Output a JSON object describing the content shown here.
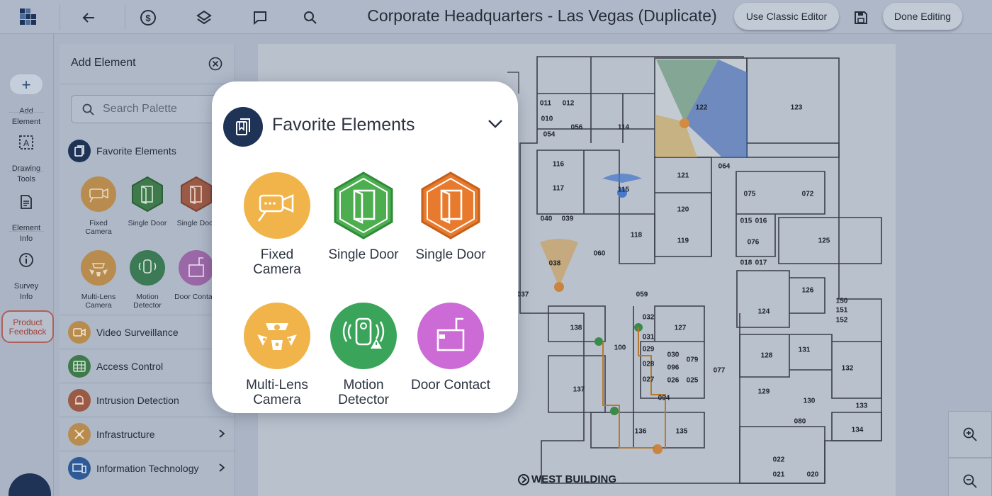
{
  "topbar": {
    "title": "Corporate Headquarters - Las Vegas (Duplicate)",
    "classic_editor_label": "Use Classic Editor",
    "done_editing_label": "Done Editing"
  },
  "rail": {
    "add_element": "Add\nElement",
    "drawing_tools": "Drawing\nTools",
    "element_info": "Element\nInfo",
    "survey_info": "Survey\nInfo",
    "product_feedback": "Product\nFeedback"
  },
  "panel": {
    "header": "Add Element",
    "search_placeholder": "Search Palette",
    "favorites_label": "Favorite Elements",
    "favorites": [
      {
        "label": "Fixed\nCamera",
        "icon": "fixed-camera-icon"
      },
      {
        "label": "Single Door",
        "icon": "single-door-icon"
      },
      {
        "label": "Single Door",
        "icon": "single-door-icon"
      },
      {
        "label": "Multi-Lens\nCamera",
        "icon": "multi-lens-camera-icon"
      },
      {
        "label": "Motion\nDetector",
        "icon": "motion-detector-icon"
      },
      {
        "label": "Door Contact",
        "icon": "door-contact-icon"
      }
    ],
    "categories": [
      {
        "label": "Video Surveillance",
        "color": "#d9893a"
      },
      {
        "label": "Access Control",
        "color": "#3f8f4a"
      },
      {
        "label": "Intrusion Detection",
        "color": "#c9553d"
      },
      {
        "label": "Infrastructure",
        "color": "#d9893a"
      },
      {
        "label": "Information Technology",
        "color": "#2f64b5"
      }
    ]
  },
  "popover": {
    "title": "Favorite Elements",
    "tiles": [
      {
        "label": "Fixed\nCamera",
        "icon": "fixed-camera-icon",
        "color": "#f0b44a"
      },
      {
        "label": "Single Door",
        "icon": "single-door-icon",
        "color": "#4cae4f"
      },
      {
        "label": "Single Door",
        "icon": "single-door-icon",
        "color": "#e87a2e"
      },
      {
        "label": "Multi-Lens\nCamera",
        "icon": "multi-lens-camera-icon",
        "color": "#f0b44a"
      },
      {
        "label": "Motion\nDetector",
        "icon": "motion-detector-icon",
        "color": "#3aa55a"
      },
      {
        "label": "Door Contact",
        "icon": "door-contact-icon",
        "color": "#cc6ad6"
      }
    ]
  },
  "floorplan": {
    "building_label": "WEST BUILDING",
    "rooms": [
      "011",
      "012",
      "010",
      "054",
      "056",
      "114",
      "122",
      "123",
      "116",
      "117",
      "115",
      "121",
      "064",
      "075",
      "072",
      "040",
      "039",
      "120",
      "015",
      "016",
      "118",
      "119",
      "076",
      "125",
      "060",
      "038",
      "018",
      "017",
      "037",
      "059",
      "126",
      "124",
      "150",
      "151",
      "152",
      "032",
      "138",
      "127",
      "031",
      "100",
      "029",
      "030",
      "079",
      "128",
      "131",
      "132",
      "028",
      "096",
      "137",
      "027",
      "026",
      "025",
      "077",
      "129",
      "130",
      "094",
      "133",
      "080",
      "136",
      "135",
      "134",
      "022",
      "021",
      "020"
    ]
  }
}
